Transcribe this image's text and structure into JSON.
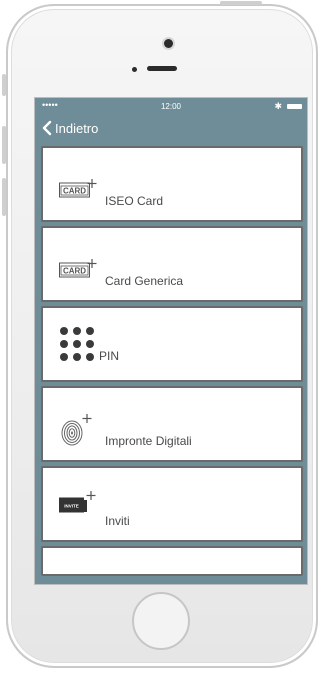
{
  "status_bar": {
    "signal": "•••••",
    "time": "12:00",
    "bluetooth": "✱"
  },
  "nav": {
    "back_label": "Indietro"
  },
  "items": [
    {
      "label": "ISEO Card",
      "icon": "card-add-icon",
      "badge_text": "CARD"
    },
    {
      "label": "Card Generica",
      "icon": "card-add-icon",
      "badge_text": "CARD"
    },
    {
      "label": "PIN",
      "icon": "pin-keypad-icon"
    },
    {
      "label": "Impronte Digitali",
      "icon": "fingerprint-add-icon"
    },
    {
      "label": "Inviti",
      "icon": "invite-add-icon",
      "badge_text": "INVITE"
    }
  ],
  "colors": {
    "header_bg": "#6f8d98",
    "item_border": "#6a6a6a",
    "text": "#4a4a4a"
  }
}
